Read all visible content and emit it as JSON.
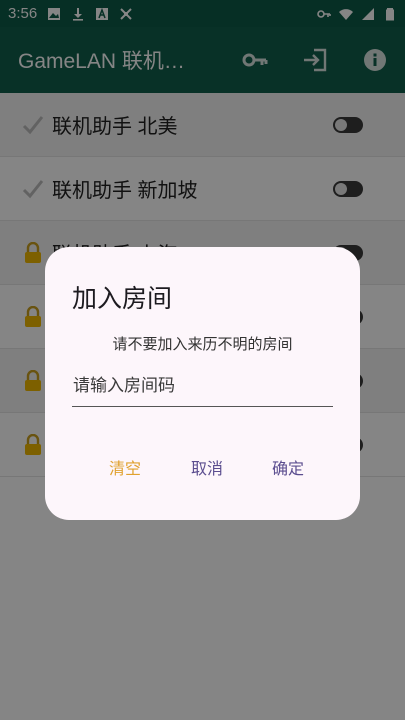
{
  "statusbar": {
    "time": "3:56",
    "icons_left": [
      "image-icon",
      "download-icon",
      "a-badge-icon",
      "crosshair-icon"
    ],
    "icons_right": [
      "key-icon",
      "wifi-icon",
      "signal-icon",
      "battery-icon"
    ]
  },
  "appbar": {
    "title": "GameLAN 联机…",
    "actions": [
      "key-icon",
      "login-icon",
      "info-icon"
    ]
  },
  "list": {
    "items": [
      {
        "label": "联机助手 北美",
        "lead_icon": "check-icon"
      },
      {
        "label": "联机助手 新加坡",
        "lead_icon": "check-icon"
      },
      {
        "label": "联机助手 上海",
        "lead_icon": "lock-icon"
      },
      {
        "label": "",
        "lead_icon": "lock-icon"
      },
      {
        "label": "",
        "lead_icon": "lock-icon"
      },
      {
        "label": "",
        "lead_icon": "lock-icon"
      }
    ]
  },
  "dialog": {
    "title": "加入房间",
    "message": "请不要加入来历不明的房间",
    "input_placeholder": "请输入房间码",
    "input_value": "",
    "buttons": {
      "clear": "清空",
      "cancel": "取消",
      "ok": "确定"
    }
  },
  "colors": {
    "appbar": "#115e4b",
    "statusbar": "#0d5a47",
    "dialog_bg": "#fdf6fb",
    "clear_btn": "#e0a12e",
    "primary_btn": "#5b4d8f"
  }
}
